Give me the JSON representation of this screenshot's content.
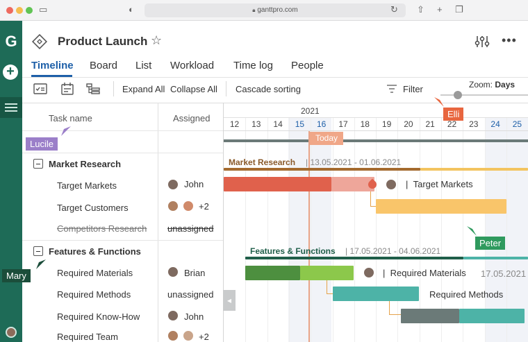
{
  "browser": {
    "url": "ganttpro.com"
  },
  "project": {
    "title": "Product Launch"
  },
  "tabs": [
    {
      "label": "Timeline",
      "active": true
    },
    {
      "label": "Board"
    },
    {
      "label": "List"
    },
    {
      "label": "Workload"
    },
    {
      "label": "Time log"
    },
    {
      "label": "People"
    }
  ],
  "toolbar": {
    "expand_all": "Expand All",
    "collapse_all": "Collapse All",
    "cascade_sorting": "Cascade sorting",
    "filter": "Filter",
    "zoom_label": "Zoom:",
    "zoom_value": "Days"
  },
  "grid": {
    "col_task": "Task name",
    "col_assigned": "Assigned",
    "rows": [
      {
        "type": "group",
        "name": "Market Research"
      },
      {
        "type": "task",
        "name": "Target Markets",
        "assigned": "John"
      },
      {
        "type": "task",
        "name": "Target Customers",
        "assigned": "+2"
      },
      {
        "type": "task",
        "name": "Competitors Research",
        "assigned": "unassigned",
        "done": true
      },
      {
        "type": "group",
        "name": "Features & Functions"
      },
      {
        "type": "task",
        "name": "Required Materials",
        "assigned": "Brian"
      },
      {
        "type": "task",
        "name": "Required Methods",
        "assigned": "unassigned"
      },
      {
        "type": "task",
        "name": "Required Know-How",
        "assigned": "John"
      },
      {
        "type": "task",
        "name": "Required Team",
        "assigned": "+2"
      }
    ]
  },
  "timeline": {
    "year": "2021",
    "days": [
      "12",
      "13",
      "14",
      "15",
      "16",
      "17",
      "18",
      "19",
      "20",
      "21",
      "22",
      "23",
      "24",
      "25"
    ],
    "today_label": "Today",
    "groups": [
      {
        "name": "Market Research",
        "dates": "13.05.2021 - 01.06.2021"
      },
      {
        "name": "Features & Functions",
        "dates": "17.05.2021 - 04.06.2021"
      }
    ],
    "bar_labels": {
      "target_markets": "Target Markets",
      "required_materials": "Required Materials",
      "required_materials_date": "17.05.2021",
      "required_methods": "Required Methods"
    }
  },
  "collaborators": {
    "lucile": "Lucile",
    "elli": "Elli",
    "peter": "Peter",
    "mary": "Mary"
  },
  "colors": {
    "accent": "#1d5fa8",
    "rail": "#1e6b57",
    "market_group": "#8a5a2a",
    "features_group": "#1f5e49",
    "red_bar": "#e0614c",
    "orange_bar": "#f9c56a",
    "green_bar": "#4d8f3f",
    "teal_bar": "#4db3a7",
    "gray_bar": "#6b7a78"
  }
}
